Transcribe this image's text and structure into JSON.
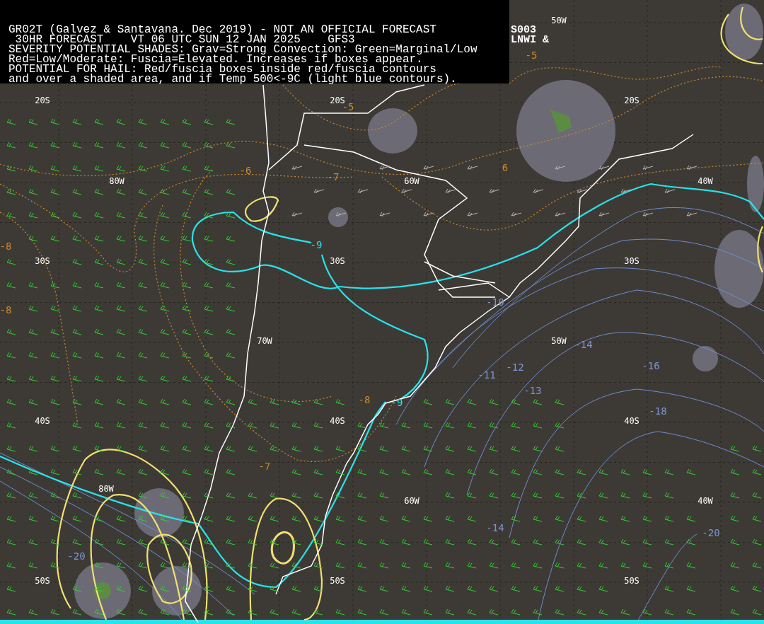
{
  "header": {
    "lines": [
      "GR02T (Galvez & Santavana. Dec 2019) - NOT AN OFFICIAL FORECAST",
      " 30HR FORECAST    VT 06 UTC SUN 12 JAN 2025    GFS3",
      "SEVERITY POTENTIAL SHADES: Grav=Strong Convection: Green=Marginal/Low",
      "Red=Low/Moderate: Fuscia=Elevated. Increases if boxes appear.",
      "POTENTIAL FOR HAIL: Red/fuscia boxes inside red/fuscia contours",
      "and over a shaded area, and if Temp 500<-9C (light blue contours)."
    ]
  },
  "corner_text": [
    "S003",
    "LNWI &"
  ],
  "grid_labels": [
    "50W",
    "20S",
    "20S",
    "20S",
    "80W",
    "60W",
    "40W",
    "30S",
    "30S",
    "30S",
    "70W",
    "50W",
    "40S",
    "40S",
    "40S",
    "80W",
    "60W",
    "40W",
    "50S",
    "50S",
    "50S"
  ],
  "contour_labels": [
    {
      "text": "-5",
      "kind": "temp850"
    },
    {
      "text": "-5",
      "kind": "temp850"
    },
    {
      "text": "-6",
      "kind": "temp850"
    },
    {
      "text": "-7",
      "kind": "temp850"
    },
    {
      "text": "6",
      "kind": "temp850"
    },
    {
      "text": "-8",
      "kind": "temp850"
    },
    {
      "text": "-8",
      "kind": "temp850"
    },
    {
      "text": "-8",
      "kind": "temp850"
    },
    {
      "text": "-7",
      "kind": "temp850"
    },
    {
      "text": "-9",
      "kind": "threshold"
    },
    {
      "text": "-9",
      "kind": "threshold"
    },
    {
      "text": "-10",
      "kind": "temp500"
    },
    {
      "text": "-14",
      "kind": "temp500"
    },
    {
      "text": "-12",
      "kind": "temp500"
    },
    {
      "text": "-11",
      "kind": "temp500"
    },
    {
      "text": "-13",
      "kind": "temp500"
    },
    {
      "text": "-16",
      "kind": "temp500"
    },
    {
      "text": "-18",
      "kind": "temp500"
    },
    {
      "text": "-14",
      "kind": "temp500"
    },
    {
      "text": "-20",
      "kind": "temp500"
    },
    {
      "text": "-20",
      "kind": "temp500"
    }
  ]
}
